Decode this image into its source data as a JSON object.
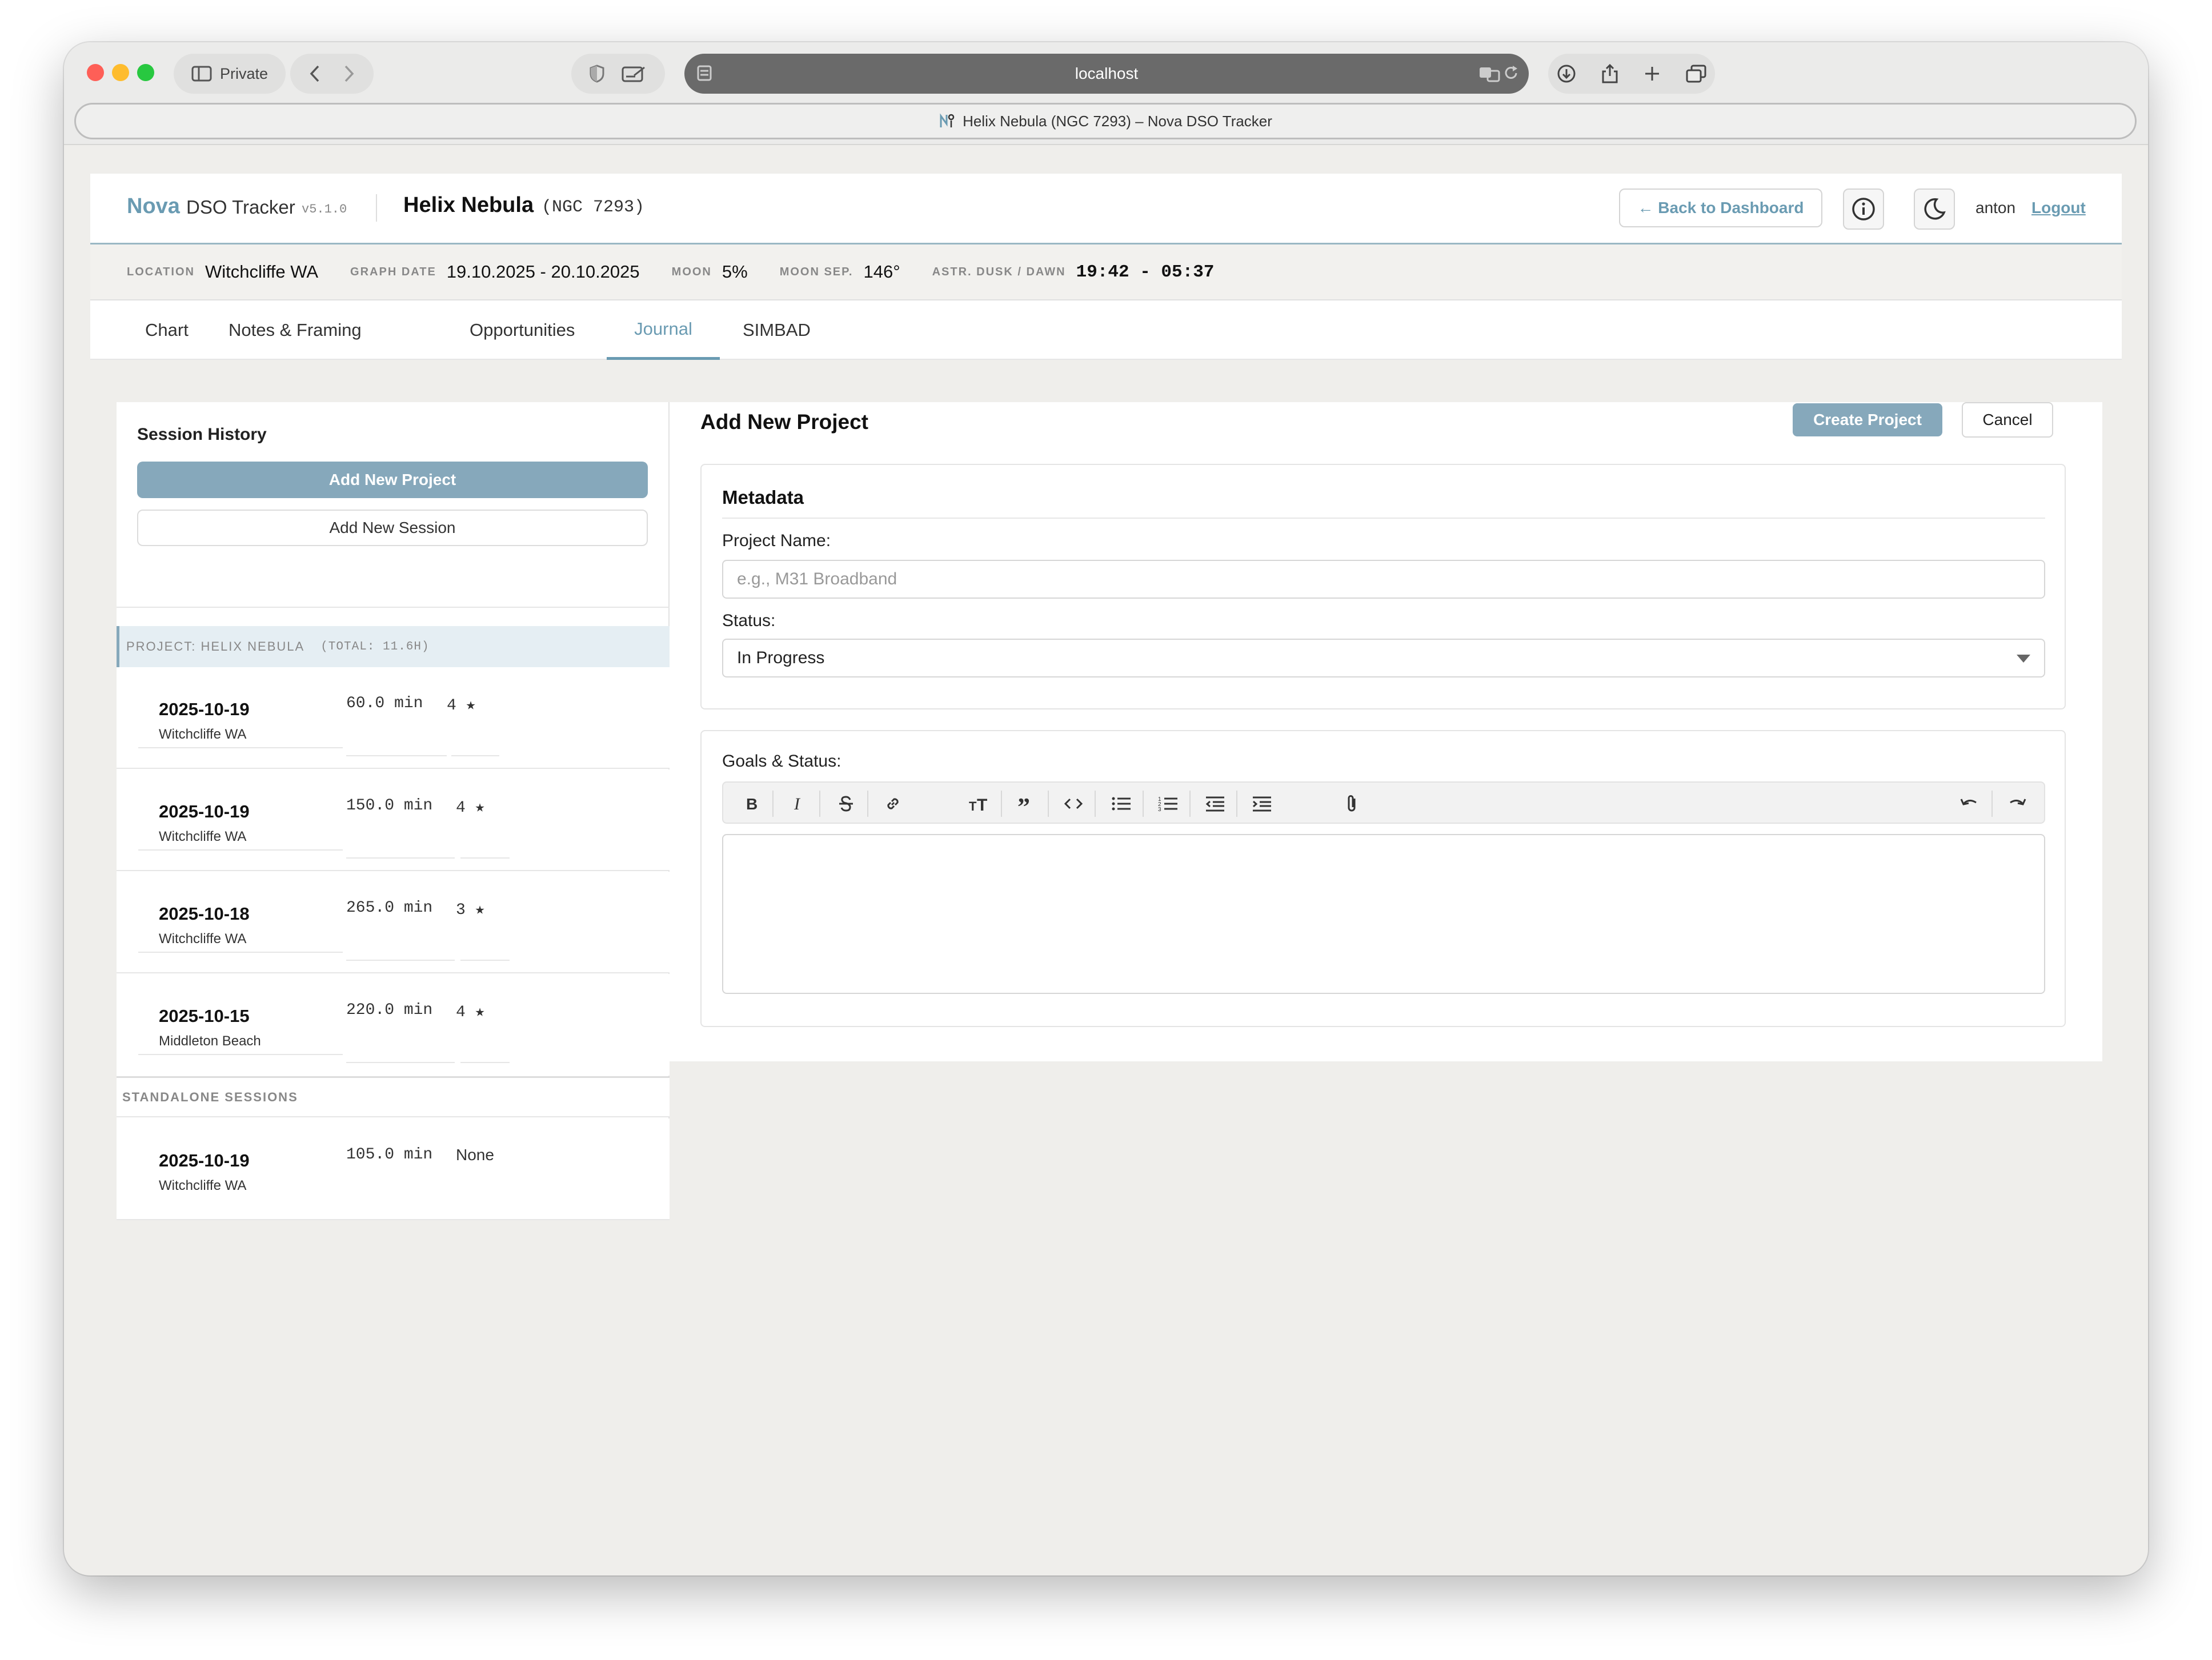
{
  "browser": {
    "private_label": "Private",
    "url": "localhost",
    "tab_title": "Helix Nebula (NGC 7293) – Nova DSO Tracker"
  },
  "header": {
    "brand": "Nova",
    "app_name": "DSO Tracker",
    "version": "v5.1.0",
    "object_name": "Helix Nebula",
    "object_code": "(NGC 7293)",
    "back_button": "← Back to Dashboard",
    "username": "anton",
    "logout": "Logout"
  },
  "info": {
    "location_label": "LOCATION",
    "location": "Witchcliffe WA",
    "graph_date_label": "GRAPH DATE",
    "graph_date": "19.10.2025 - 20.10.2025",
    "moon_label": "MOON",
    "moon": "5%",
    "moon_sep_label": "MOON SEP.",
    "moon_sep": "146°",
    "dusk_label": "ASTR. DUSK / DAWN",
    "dusk": "19:42 - 05:37"
  },
  "tabs": [
    "Chart",
    "Notes & Framing",
    "Opportunities",
    "Journal",
    "SIMBAD"
  ],
  "active_tab": "Journal",
  "sidebar": {
    "title": "Session History",
    "add_project": "Add New Project",
    "add_session": "Add New Session",
    "project_header": "PROJECT: HELIX NEBULA",
    "project_total": "(TOTAL: 11.6H)",
    "project_sessions": [
      {
        "date": "2025-10-19",
        "location": "Witchcliffe WA",
        "minutes": "60.0 min",
        "rating": "4 ★"
      },
      {
        "date": "2025-10-19",
        "location": "Witchcliffe WA",
        "minutes": "150.0 min",
        "rating": "4 ★"
      },
      {
        "date": "2025-10-18",
        "location": "Witchcliffe WA",
        "minutes": "265.0 min",
        "rating": "3 ★"
      },
      {
        "date": "2025-10-15",
        "location": "Middleton Beach",
        "minutes": "220.0 min",
        "rating": "4 ★"
      }
    ],
    "standalone_header": "STANDALONE SESSIONS",
    "standalone_sessions": [
      {
        "date": "2025-10-19",
        "location": "Witchcliffe WA",
        "minutes": "105.0 min",
        "rating": "None"
      }
    ]
  },
  "form": {
    "title": "Add New Project",
    "create_button": "Create Project",
    "cancel_button": "Cancel",
    "metadata_heading": "Metadata",
    "project_name_label": "Project Name:",
    "project_name_placeholder": "e.g., M31 Broadband",
    "project_name_value": "",
    "status_label": "Status:",
    "status_value": "In Progress",
    "goals_label": "Goals & Status:",
    "toolbar_icons": [
      "bold-icon",
      "italic-icon",
      "strikethrough-icon",
      "link-icon",
      "heading-icon",
      "quote-icon",
      "code-icon",
      "bullet-list-icon",
      "numbered-list-icon",
      "decrease-indent-icon",
      "increase-indent-icon",
      "attach-icon",
      "undo-icon",
      "redo-icon"
    ]
  },
  "colors": {
    "accent": "#6a9bb2",
    "button_fill": "#86a8bb",
    "page_bg": "#efeeeb"
  }
}
